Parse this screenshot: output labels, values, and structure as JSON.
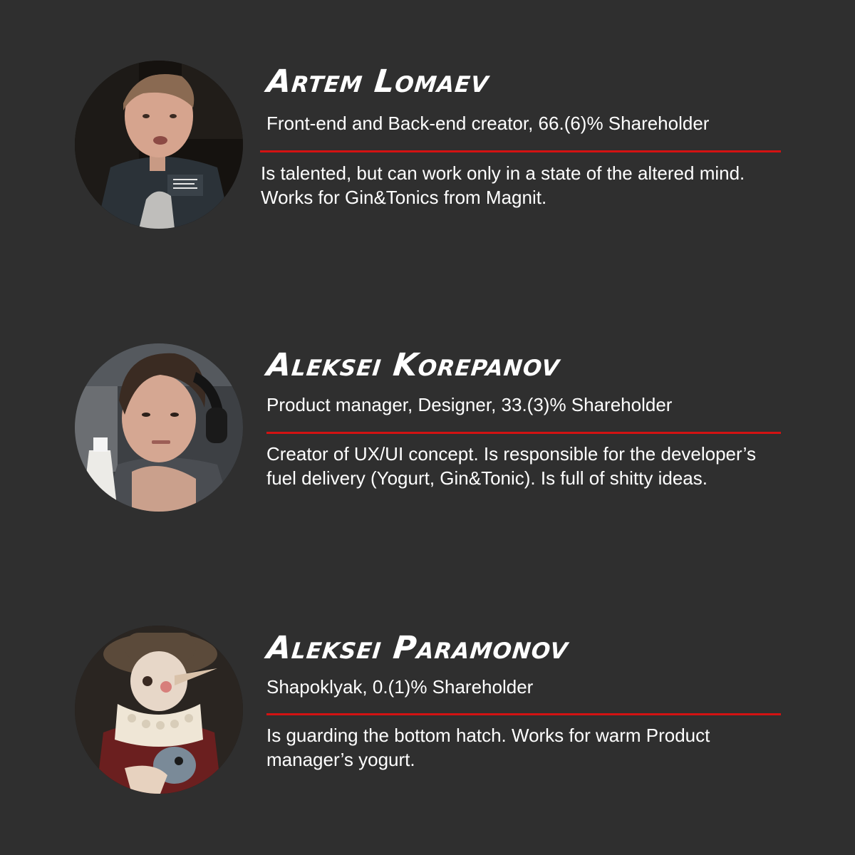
{
  "colors": {
    "background": "#2f2f2f",
    "accent": "#d31212",
    "text": "#ffffff"
  },
  "team": [
    {
      "name": "Artem Lomaev",
      "role": "Front-end and Back-end creator, 66.(6)% Shareholder",
      "description": "Is talented, but can work only in a state of the altered mind. Works for Gin&Tonics from Magnit."
    },
    {
      "name": "Aleksei Korepanov",
      "role": "Product manager, Designer, 33.(3)% Shareholder",
      "description": "Creator of UX/UI concept. Is responsible for the developer’s fuel delivery (Yogurt, Gin&Tonic). Is full of shitty ideas."
    },
    {
      "name": "Aleksei Paramonov",
      "role": "Shapoklyak, 0.(1)% Shareholder",
      "description": "Is guarding the bottom hatch. Works for warm Product manager’s yogurt."
    }
  ]
}
